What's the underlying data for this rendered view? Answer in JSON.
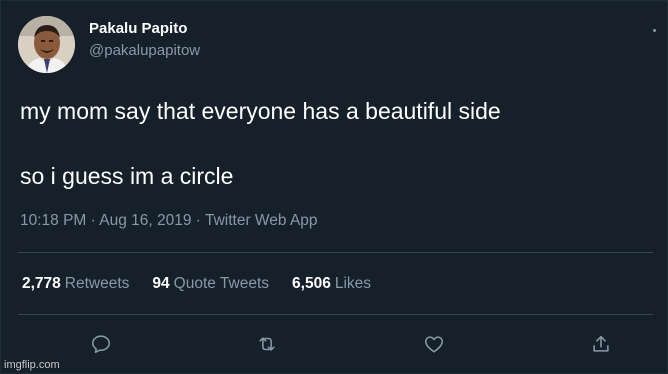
{
  "user": {
    "display_name": "Pakalu Papito",
    "handle": "@pakalupapitow"
  },
  "tweet": {
    "line1": "my mom say that everyone has a beautiful side",
    "line2": "so i guess im a circle",
    "meta": "10:18 PM · Aug 16, 2019 · Twitter Web App"
  },
  "stats": {
    "retweets_count": "2,778",
    "retweets_label": "Retweets",
    "quotes_count": "94",
    "quotes_label": "Quote Tweets",
    "likes_count": "6,506",
    "likes_label": "Likes"
  },
  "icons": {
    "reply": "reply-icon",
    "retweet": "retweet-icon",
    "like": "heart-icon",
    "share": "share-icon",
    "more": "more-icon"
  },
  "colors": {
    "background": "#15202b",
    "text": "#ffffff",
    "secondary": "#8899a6",
    "divider": "#38444d"
  },
  "watermark": "imgflip.com"
}
